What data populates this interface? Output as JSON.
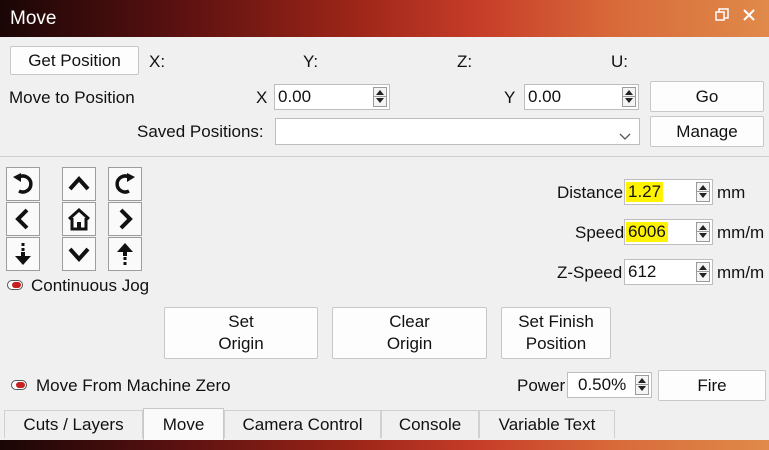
{
  "window": {
    "title": "Move"
  },
  "position": {
    "get_position_label": "Get Position",
    "x_label": "X:",
    "y_label": "Y:",
    "z_label": "Z:",
    "u_label": "U:"
  },
  "move_to": {
    "label": "Move to Position",
    "x_label": "X",
    "x_value": "0.00",
    "y_label": "Y",
    "y_value": "0.00",
    "go_label": "Go"
  },
  "saved": {
    "label": "Saved Positions:",
    "value": "",
    "manage_label": "Manage"
  },
  "jog": {
    "continuous_label": "Continuous Jog",
    "distance_label": "Distance",
    "distance_value": "1.27",
    "distance_unit": "mm",
    "speed_label": "Speed",
    "speed_value": "6006",
    "speed_unit": "mm/m",
    "zspeed_label": "Z-Speed",
    "zspeed_value": "612",
    "zspeed_unit": "mm/m"
  },
  "origin_buttons": {
    "set_origin_1": "Set",
    "set_origin_2": "Origin",
    "clear_origin_1": "Clear",
    "clear_origin_2": "Origin",
    "finish_1": "Set Finish",
    "finish_2": "Position"
  },
  "machine_zero": {
    "label": "Move From Machine Zero"
  },
  "power": {
    "label": "Power",
    "value": "0.50%",
    "fire_label": "Fire"
  },
  "tabs": [
    {
      "label": "Cuts / Layers"
    },
    {
      "label": "Move"
    },
    {
      "label": "Camera Control"
    },
    {
      "label": "Console"
    },
    {
      "label": "Variable Text"
    }
  ],
  "colors": {
    "highlight": "#fff200",
    "toggle_on": "#c62020"
  },
  "icons": [
    "restore-icon",
    "close-icon",
    "rotate-ccw-icon",
    "arrow-up-icon",
    "rotate-cw-icon",
    "arrow-left-icon",
    "home-icon",
    "arrow-right-icon",
    "z-down-icon",
    "arrow-down-icon",
    "z-up-icon"
  ]
}
